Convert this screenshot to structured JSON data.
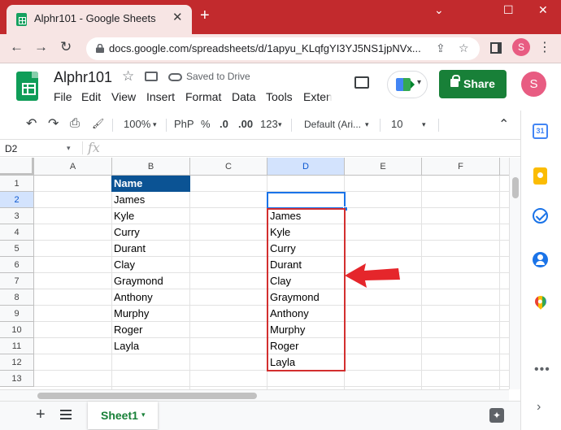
{
  "browser": {
    "tab_title": "Alphr101 - Google Sheets",
    "url": "docs.google.com/spreadsheets/d/1apyu_KLqfgYI3YJ5NS1jpNVx...",
    "profile_initial": "S",
    "close_glyph": "✕",
    "new_tab_glyph": "+",
    "back_glyph": "←",
    "forward_glyph": "→",
    "reload_glyph": "↻",
    "share_page_glyph": "⇪",
    "bookmark_glyph": "☆",
    "minimize_glyph": "⌄",
    "maximize_glyph": "☐",
    "window_close_glyph": "✕",
    "menu_glyph": "⋮"
  },
  "header": {
    "doc_title": "Alphr101",
    "star_glyph": "☆",
    "saved_status": "Saved to Drive",
    "menu": [
      "File",
      "Edit",
      "View",
      "Insert",
      "Format",
      "Data",
      "Tools",
      "Exten"
    ],
    "share_label": "Share",
    "account_initial": "S",
    "meet_caret": "▾"
  },
  "toolbar": {
    "undo": "↶",
    "redo": "↷",
    "print": "⎙",
    "paint_format": "🖌",
    "zoom": "100%",
    "zoom_caret": "▾",
    "currency": "PhP",
    "percent": "%",
    "decrease_decimal": ".0",
    "increase_decimal": ".00",
    "more_formats": "123",
    "more_formats_caret": "▾",
    "font": "Default (Ari...",
    "font_caret": "▾",
    "font_size": "10",
    "font_size_caret": "▾",
    "collapse": "⌃"
  },
  "formula_bar": {
    "name_box": "D2",
    "name_caret": "▾",
    "fx_label": "fx",
    "content": ""
  },
  "grid": {
    "columns": [
      "A",
      "B",
      "C",
      "D",
      "E",
      "F"
    ],
    "rows": [
      "1",
      "2",
      "3",
      "4",
      "5",
      "6",
      "7",
      "8",
      "9",
      "10",
      "11",
      "12",
      "13"
    ],
    "selected_column": "D",
    "selected_row": "2",
    "column_b": [
      "Name",
      "James",
      "Kyle",
      "Curry",
      "Durant",
      "Clay",
      "Graymond",
      "Anthony",
      "Murphy",
      "Roger",
      "Layla",
      "",
      ""
    ],
    "column_d": [
      "",
      "",
      "James",
      "Kyle",
      "Curry",
      "Durant",
      "Clay",
      "Graymond",
      "Anthony",
      "Murphy",
      "Roger",
      "Layla",
      ""
    ]
  },
  "colors": {
    "browser_accent": "#c22a2d",
    "share_green": "#188038",
    "header_cell_blue": "#0b5394",
    "highlight_red": "#d32f2f",
    "selection_blue": "#1a73e8"
  },
  "sheetbar": {
    "add_glyph": "+",
    "sheet_name": "Sheet1",
    "sheet_caret": "▾",
    "explore_glyph": "✦"
  },
  "side_panel": {
    "calendar_day": "31",
    "more_glyph": "•••",
    "expand_glyph": "›"
  }
}
